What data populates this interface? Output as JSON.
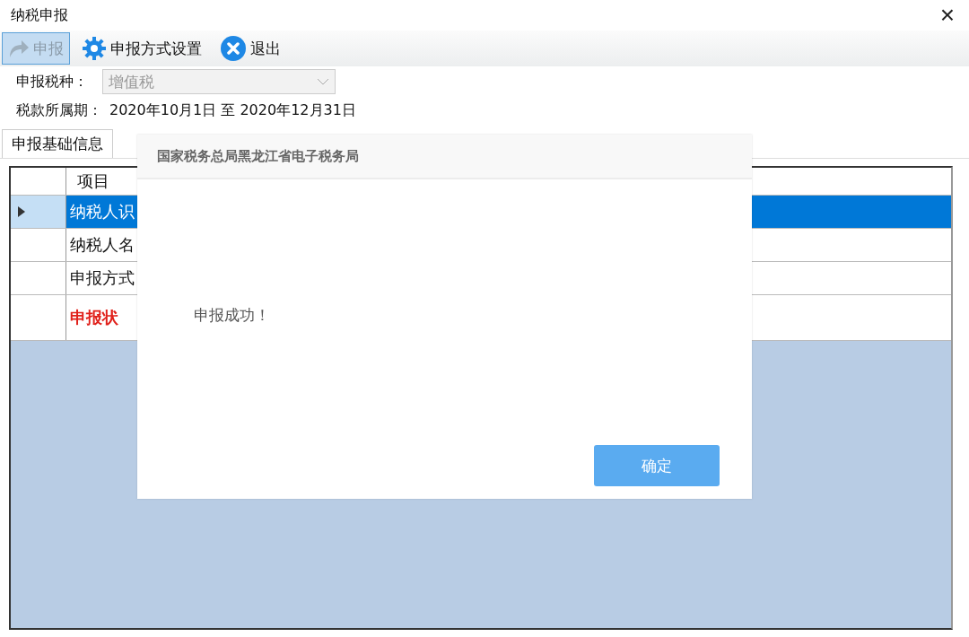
{
  "window": {
    "title": "纳税申报",
    "close": "×"
  },
  "toolbar": [
    {
      "kind": "submit",
      "label": "申报",
      "selected": true
    },
    {
      "kind": "settings",
      "label": "申报方式设置",
      "selected": false
    },
    {
      "kind": "exit",
      "label": "退出",
      "selected": false
    }
  ],
  "form": {
    "tax_type_label": "申报税种：",
    "tax_type_value": "增值税",
    "period_label": "税款所属期：",
    "period_value": "2020年10月1日 至 2020年12月31日"
  },
  "tabs": [
    {
      "label": "申报基础信息",
      "selected": true
    }
  ],
  "table": {
    "columns": [
      "项目"
    ],
    "rows": [
      {
        "cells": [
          "纳税人识"
        ],
        "selected": true,
        "kind": "normal"
      },
      {
        "cells": [
          "纳税人名"
        ],
        "selected": false,
        "kind": "normal"
      },
      {
        "cells": [
          "申报方式"
        ],
        "selected": false,
        "kind": "normal"
      },
      {
        "cells": [
          "申报状"
        ],
        "selected": false,
        "kind": "status"
      }
    ]
  },
  "dialog": {
    "title": "国家税务总局黑龙江省电子税务局",
    "message": "申报成功！",
    "button": "确定"
  }
}
